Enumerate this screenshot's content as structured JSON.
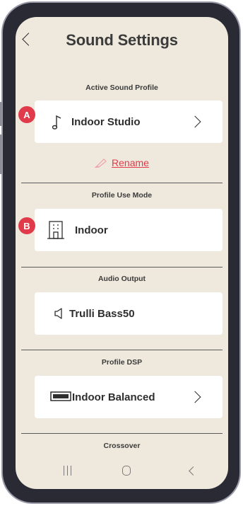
{
  "header": {
    "title": "Sound Settings"
  },
  "active_sound_profile": {
    "section_label": "Active Sound Profile",
    "value": "Indoor Studio",
    "badge": "A",
    "icon": "music-note-icon",
    "rename_label": "Rename"
  },
  "profile_use_mode": {
    "section_label": "Profile Use Mode",
    "value": "Indoor",
    "badge": "B",
    "icon": "building-icon"
  },
  "audio_output": {
    "section_label": "Audio Output",
    "value": "Trulli Bass50",
    "icon": "speaker-icon"
  },
  "profile_dsp": {
    "section_label": "Profile DSP",
    "value": "Indoor Balanced",
    "icon": "dsp-device-icon"
  },
  "crossover": {
    "section_label": "Crossover"
  },
  "colors": {
    "accent": "#e03a4b",
    "background": "#efe9dd",
    "card": "#ffffff",
    "text": "#2e2e2e"
  }
}
